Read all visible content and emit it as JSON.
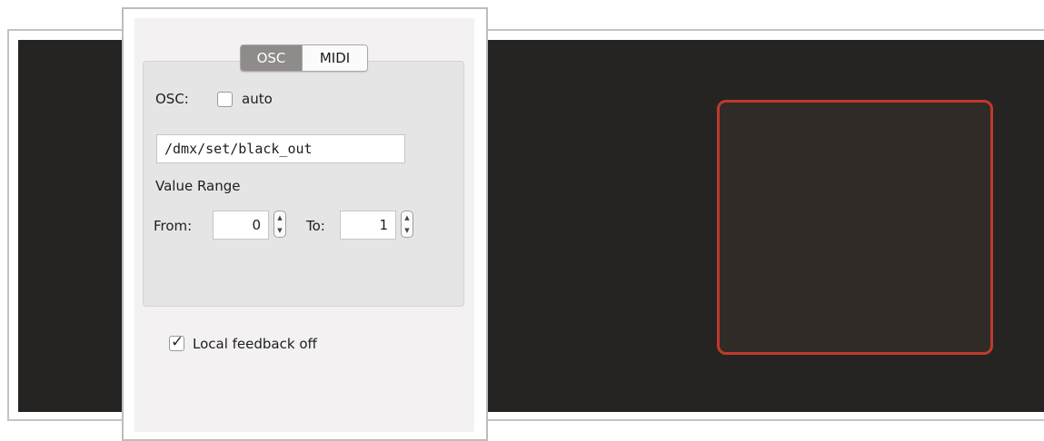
{
  "tabs": [
    {
      "label": "OSC",
      "active": true
    },
    {
      "label": "MIDI",
      "active": false
    }
  ],
  "osc": {
    "label": "OSC:",
    "auto_label": "auto",
    "auto_checked": false,
    "address": "/dmx/set/black_out"
  },
  "value_range": {
    "heading": "Value Range",
    "from_label": "From:",
    "from_value": "0",
    "to_label": "To:",
    "to_value": "1"
  },
  "feedback": {
    "label": "Local feedback off",
    "checked": true
  },
  "colors": {
    "canvas_background": "#252423",
    "pad_border": "#c0392b",
    "pad_fill": "#302b27"
  },
  "icons": {
    "stepper_up": "stepper-up-icon",
    "stepper_down": "stepper-down-icon",
    "checkmark": "checkmark-icon"
  }
}
